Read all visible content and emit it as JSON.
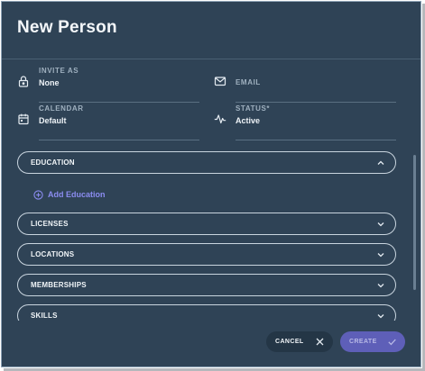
{
  "dialog": {
    "title": "New Person"
  },
  "fields": {
    "invite_as": {
      "label": "INVITE AS",
      "value": "None",
      "icon": "lock-icon"
    },
    "email": {
      "label": "EMAIL",
      "value": "",
      "icon": "mail-icon"
    },
    "calendar": {
      "label": "CALENDAR",
      "value": "Default",
      "icon": "calendar-icon"
    },
    "status": {
      "label": "STATUS*",
      "value": "Active",
      "icon": "activity-icon"
    }
  },
  "sections": [
    {
      "title": "EDUCATION",
      "expanded": true
    },
    {
      "title": "LICENSES",
      "expanded": false
    },
    {
      "title": "LOCATIONS",
      "expanded": false
    },
    {
      "title": "MEMBERSHIPS",
      "expanded": false
    },
    {
      "title": "SKILLS",
      "expanded": false
    }
  ],
  "education": {
    "add_label": "Add Education"
  },
  "footer": {
    "cancel_label": "CANCEL",
    "create_label": "CREATE"
  },
  "colors": {
    "background": "#2f4356",
    "accent": "#8b8cf0",
    "create_button": "#5e5fb8"
  }
}
